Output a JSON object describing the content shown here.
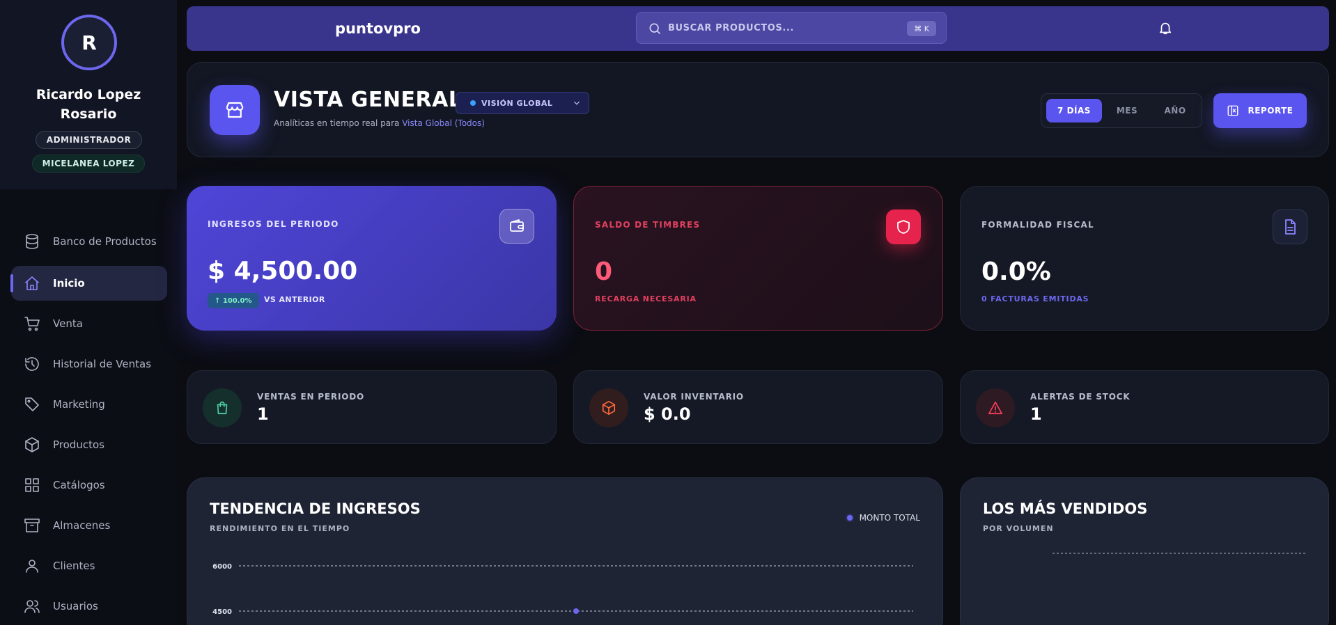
{
  "sidebar": {
    "avatar_initial": "R",
    "user_name": "Ricardo Lopez Rosario",
    "role": "ADMINISTRADOR",
    "store": "MICELANEA LOPEZ",
    "items": [
      {
        "label": "Banco de Productos",
        "icon": "database-icon"
      },
      {
        "label": "Inicio",
        "icon": "home-icon",
        "active": true
      },
      {
        "label": "Venta",
        "icon": "cart-icon"
      },
      {
        "label": "Historial de Ventas",
        "icon": "history-icon"
      },
      {
        "label": "Marketing",
        "icon": "tag-icon"
      },
      {
        "label": "Productos",
        "icon": "box-icon"
      },
      {
        "label": "Catálogos",
        "icon": "grid-icon"
      },
      {
        "label": "Almacenes",
        "icon": "archive-icon"
      },
      {
        "label": "Clientes",
        "icon": "user-icon"
      },
      {
        "label": "Usuarios",
        "icon": "users-icon"
      }
    ]
  },
  "topbar": {
    "brand": "puntovpro",
    "search_placeholder": "BUSCAR PRODUCTOS...",
    "shortcut": "⌘ K"
  },
  "header": {
    "title": "VISTA GENERAL",
    "scope_select": "VISIÓN GLOBAL",
    "subtitle_prefix": "Analíticas en tiempo real para",
    "subtitle_highlight": "Vista Global (Todos)",
    "ranges": [
      "7 DÍAS",
      "MES",
      "AÑO"
    ],
    "active_range": "7 DÍAS",
    "report_label": "REPORTE"
  },
  "kpis": {
    "income": {
      "label": "INGRESOS DEL PERIODO",
      "value": "$ 4,500.00",
      "trend": "↑ 100.0%",
      "trend_note": "VS ANTERIOR"
    },
    "stamps": {
      "label": "SALDO DE TIMBRES",
      "value": "0",
      "note": "RECARGA NECESARIA"
    },
    "fiscal": {
      "label": "FORMALIDAD FISCAL",
      "value": "0.0%",
      "note": "0 FACTURAS EMITIDAS"
    }
  },
  "mini_stats": [
    {
      "label": "VENTAS EN PERIODO",
      "value": "1",
      "icon": "shopping-bag-icon",
      "color": "#4fd1a6"
    },
    {
      "label": "VALOR INVENTARIO",
      "value": "$ 0.0",
      "icon": "cube-icon",
      "color": "#ff6a3d"
    },
    {
      "label": "ALERTAS DE STOCK",
      "value": "1",
      "icon": "warning-icon",
      "color": "#ff3d5e"
    }
  ],
  "trend_card": {
    "title": "TENDENCIA DE INGRESOS",
    "subtitle": "RENDIMIENTO EN EL TIEMPO",
    "legend": "MONTO TOTAL"
  },
  "top_card": {
    "title": "LOS MÁS VENDIDOS",
    "subtitle": "POR VOLUMEN"
  },
  "chart_data": {
    "type": "line",
    "series": [
      {
        "name": "MONTO TOTAL",
        "values": [
          4500
        ]
      }
    ],
    "y_ticks": [
      "6000",
      "4500"
    ],
    "ylim": [
      4500,
      6000
    ],
    "grid": true,
    "legend": "top-right",
    "color": "#6d67f0"
  }
}
